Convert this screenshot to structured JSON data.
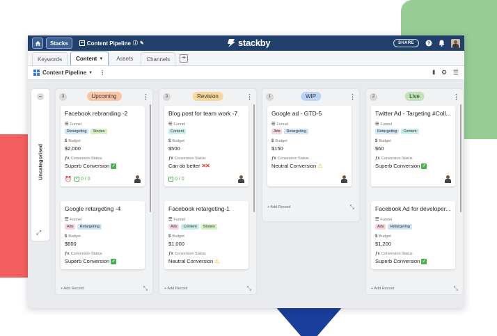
{
  "colors": {
    "topbar": "#213f6b",
    "upcoming": "#f8c4a4",
    "revision": "#f7d79b",
    "wip": "#bcd3f5",
    "live": "#bfe3b6",
    "tag_retargeting": "#cde5f6",
    "tag_stories": "#d6f0c2",
    "tag_content": "#c9eee9",
    "tag_ads": "#f7d5dc"
  },
  "topbar": {
    "stacks": "Stacks",
    "crumb": "Content Pipeline",
    "logo": "stackby",
    "share": "SHARE"
  },
  "tabs": [
    "Keywords",
    "Content",
    "Assets",
    "Channels"
  ],
  "active_tab": "Content",
  "viewbar": {
    "name": "Content Pipeline"
  },
  "uncategorised": "Uncategorised",
  "labels": {
    "funnel": "Funnel",
    "budget": "Budget",
    "conversion": "Conversion Status",
    "add_record": "+ Add Record"
  },
  "columns": [
    {
      "title": "Upcoming",
      "count": "3",
      "cards": [
        {
          "title": "Facebook rebranding -2",
          "tags": [
            "Retargeting",
            "Stories"
          ],
          "budget": "$2,000",
          "status": "Superb Conversion",
          "status_icon": "check",
          "checklist": "0 / 0",
          "alarm": true
        },
        {
          "title": "Google retargeting -4",
          "tags": [
            "Ads",
            "Retargeting"
          ],
          "budget": "$600",
          "status": "Superb Conversion",
          "status_icon": "check"
        }
      ]
    },
    {
      "title": "Revision",
      "count": "3",
      "cards": [
        {
          "title": "Blog post for team work -7",
          "tags": [
            "Content"
          ],
          "budget": "$500",
          "status": "Can do better",
          "status_icon": "x",
          "checklist": "0 / 0"
        },
        {
          "title": "Facebook retargeting-1",
          "tags": [
            "Ads",
            "Content",
            "Stories"
          ],
          "budget": "$1,000",
          "status": "Neutral Conversion",
          "status_icon": "warn"
        }
      ]
    },
    {
      "title": "WIP",
      "count": "1",
      "cards": [
        {
          "title": "Google ad - GTD-5",
          "tags": [
            "Ads",
            "Retargeting"
          ],
          "budget": "$150",
          "status": "Neutral Conversion",
          "status_icon": "warn"
        }
      ]
    },
    {
      "title": "Live",
      "count": "2",
      "cards": [
        {
          "title": "Twitter Ad - Targeting #Coll...",
          "tags": [
            "Retargeting",
            "Content"
          ],
          "budget": "$60",
          "status": "Superb Conversion",
          "status_icon": "check"
        },
        {
          "title": "Facebook Ad for developer...",
          "tags": [
            "Ads",
            "Retargeting"
          ],
          "budget": "$1,200",
          "status": "Superb Conversion",
          "status_icon": "check"
        }
      ]
    }
  ]
}
